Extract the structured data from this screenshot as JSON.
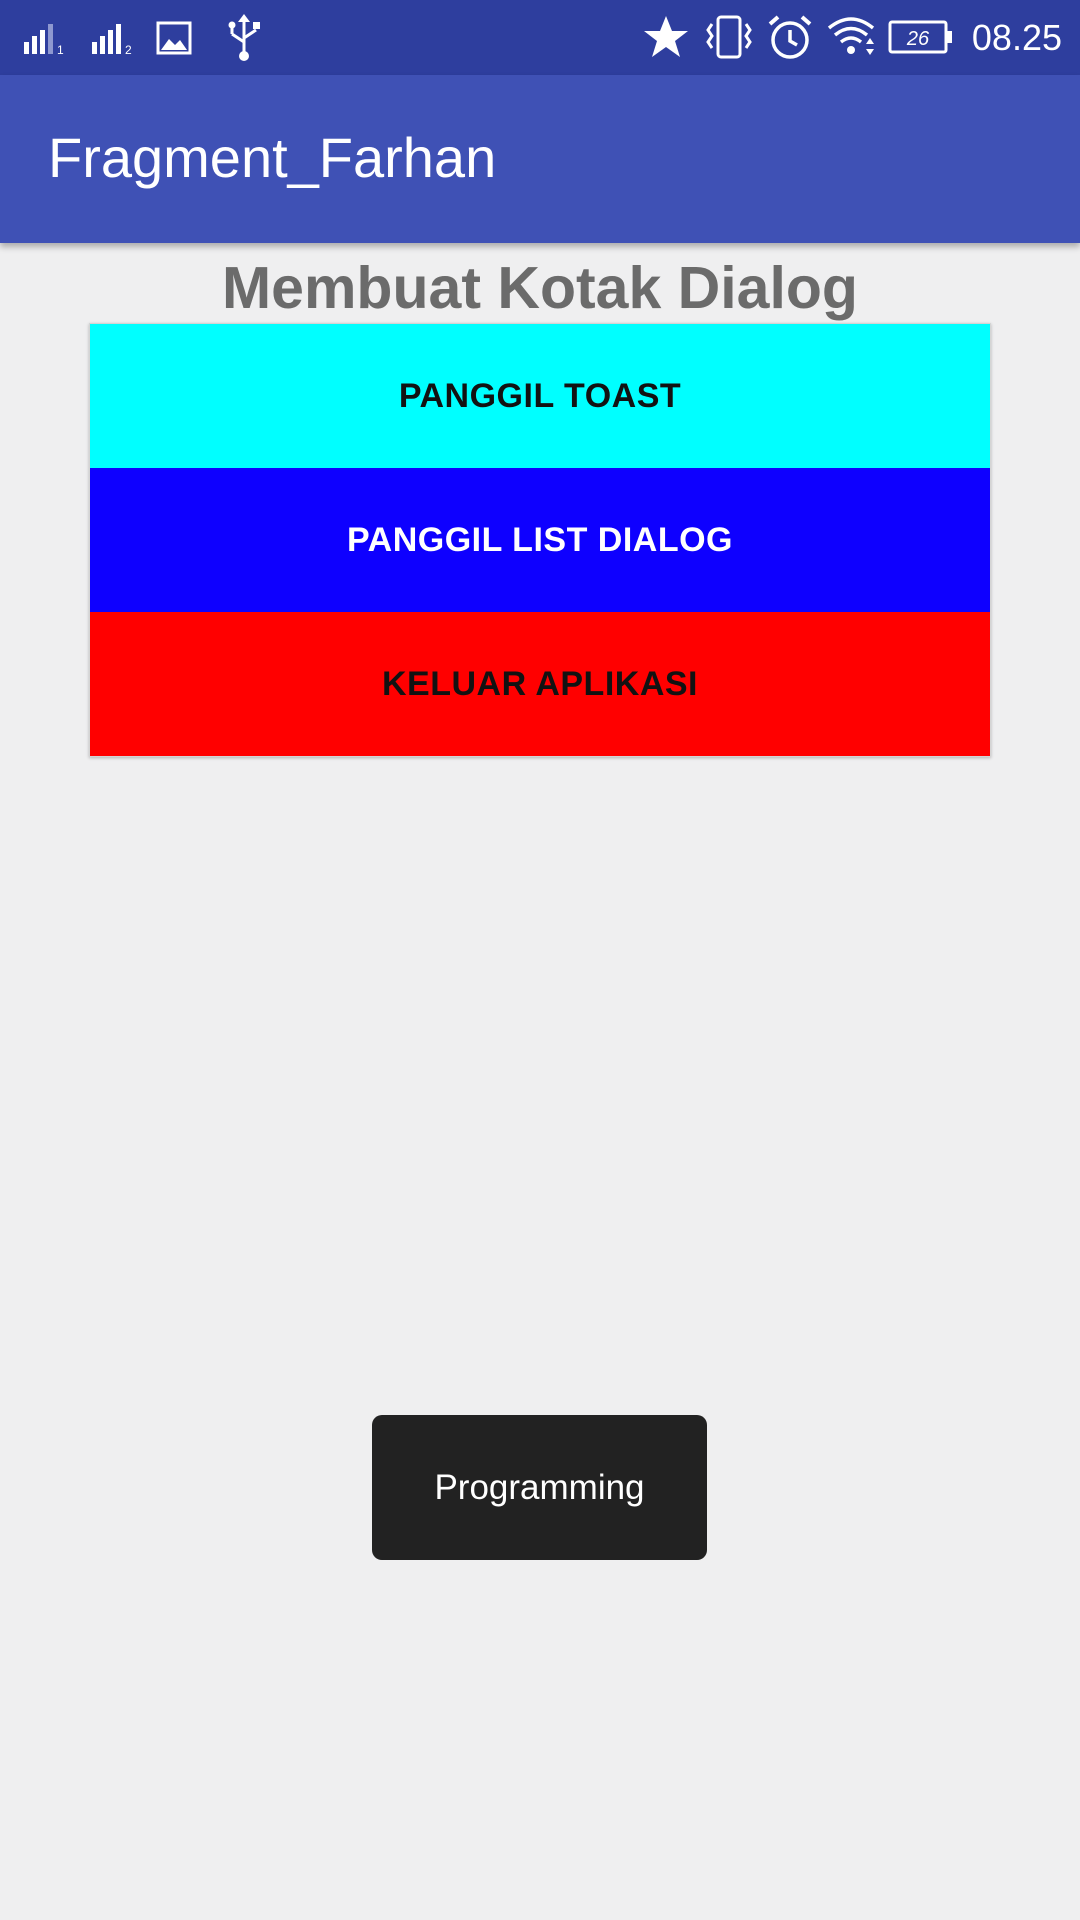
{
  "status_bar": {
    "time": "08.25",
    "battery_level": "26",
    "sim1_label": "1",
    "sim2_label": "2",
    "icons": [
      "signal-sim1-icon",
      "signal-sim2-icon",
      "image-notification-icon",
      "usb-icon",
      "star-icon",
      "vibrate-icon",
      "alarm-icon",
      "wifi-icon",
      "battery-icon"
    ]
  },
  "app_bar": {
    "title": "Fragment_Farhan"
  },
  "main": {
    "heading": "Membuat Kotak Dialog",
    "buttons": [
      {
        "label": "PANGGIL TOAST",
        "color": "#00FFFF"
      },
      {
        "label": "PANGGIL LIST DIALOG",
        "color": "#0E00FF"
      },
      {
        "label": "KELUAR APLIKASI",
        "color": "#FF0000"
      }
    ]
  },
  "toast": {
    "message": "Programming"
  },
  "colors": {
    "status_bar": "#2E3E9E",
    "app_bar": "#3F51B5",
    "background": "#EFEFF0",
    "toast": "#222222"
  }
}
